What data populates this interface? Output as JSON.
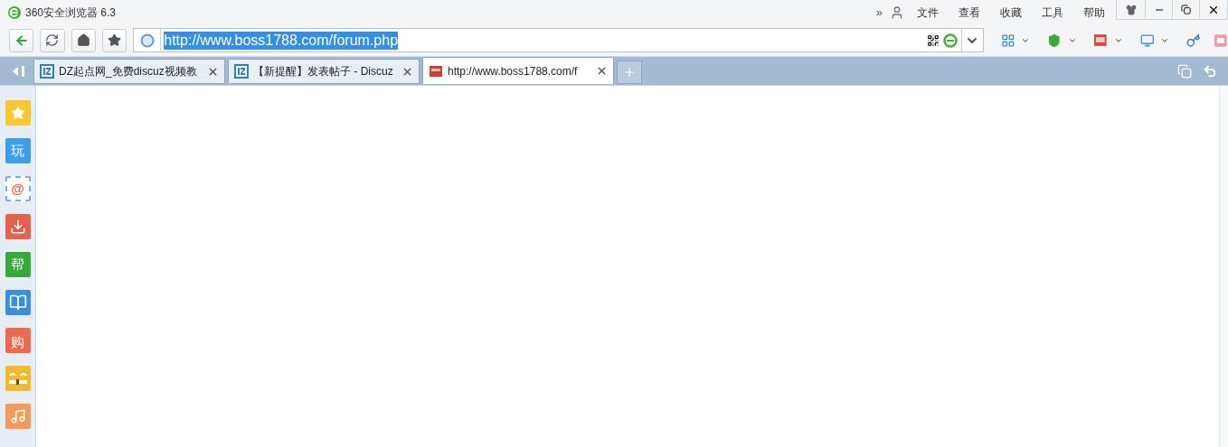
{
  "window": {
    "title": "360安全浏览器 6.3"
  },
  "menu": {
    "overflow": "»",
    "items": [
      "文件",
      "查看",
      "收藏",
      "工具",
      "帮助"
    ]
  },
  "address_bar": {
    "value": "http://www.boss1788.com/forum.php",
    "selected_text": true
  },
  "tabs": [
    {
      "label": "DZ起点网_免费discuz视频教",
      "selected": false,
      "kind": "site"
    },
    {
      "label": "【新提醒】发表帖子 - Discuz",
      "selected": false,
      "kind": "site"
    },
    {
      "label": "http://www.boss1788.com/f",
      "selected": true,
      "kind": "shop"
    }
  ],
  "sidebar": {
    "items": [
      {
        "kind": "star",
        "color": "#f8c72c"
      },
      {
        "kind": "text",
        "text": "玩",
        "color": "#3e9de8"
      },
      {
        "kind": "mail",
        "text": "@",
        "color": "#e8604c"
      },
      {
        "kind": "download",
        "color": "#e5604d"
      },
      {
        "kind": "text",
        "text": "帮",
        "color": "#36a93b"
      },
      {
        "kind": "book",
        "color": "#3a8fdc"
      },
      {
        "kind": "bag",
        "text": "购",
        "color": "#ec6a4f"
      },
      {
        "kind": "face",
        "color": "#f6b92b"
      },
      {
        "kind": "music",
        "color": "#f39a5a"
      }
    ]
  }
}
